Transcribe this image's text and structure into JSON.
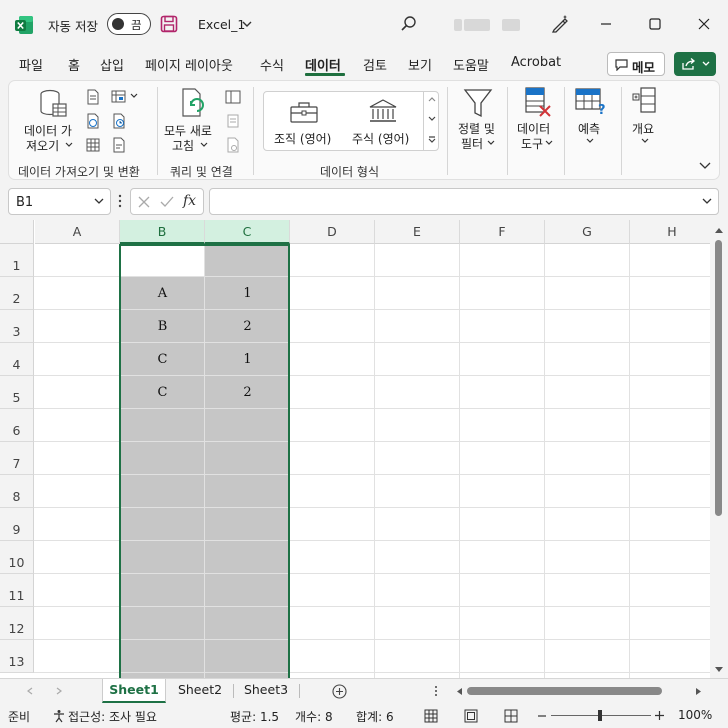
{
  "titlebar": {
    "autosave_label": "자동 저장",
    "autosave_state": "끔",
    "filename": "Excel_1",
    "colors": {
      "excel_green": "#1e7145"
    }
  },
  "tabs": [
    {
      "label": "파일"
    },
    {
      "label": "홈"
    },
    {
      "label": "삽입"
    },
    {
      "label": "페이지 레이아웃"
    },
    {
      "label": "수식"
    },
    {
      "label": "데이터",
      "active": true
    },
    {
      "label": "검토"
    },
    {
      "label": "보기"
    },
    {
      "label": "도움말"
    },
    {
      "label": "Acrobat"
    }
  ],
  "memo_label": "메모",
  "ribbon": {
    "get_data_l1": "데이터 가",
    "get_data_l2": "져오기",
    "group_get": "데이터 가져오기 및 변환",
    "refresh_l1": "모두 새로",
    "refresh_l2": "고침",
    "group_query": "쿼리 및 연결",
    "org_label": "조직 (영어)",
    "stock_label": "주식 (영어)",
    "group_types": "데이터 형식",
    "sort_l1": "정렬 및",
    "sort_l2": "필터",
    "tools_l1": "데이터",
    "tools_l2": "도구",
    "forecast": "예측",
    "outline": "개요"
  },
  "formula_bar": {
    "name_box": "B1",
    "fx": "fx",
    "formula": ""
  },
  "grid": {
    "columns": [
      "A",
      "B",
      "C",
      "D",
      "E",
      "F",
      "G",
      "H"
    ],
    "selected_columns": [
      "B",
      "C"
    ],
    "rows": [
      "1",
      "2",
      "3",
      "4",
      "5",
      "6",
      "7",
      "8",
      "9",
      "10",
      "11",
      "12",
      "13"
    ],
    "cells": {
      "B2": "A",
      "C2": "1",
      "B3": "B",
      "C3": "2",
      "B4": "C",
      "C4": "1",
      "B5": "C",
      "C5": "2"
    }
  },
  "sheets": [
    {
      "label": "Sheet1",
      "active": true
    },
    {
      "label": "Sheet2"
    },
    {
      "label": "Sheet3"
    }
  ],
  "status": {
    "ready": "준비",
    "accessibility": "접근성: 조사 필요",
    "average": "평균: 1.5",
    "count": "개수: 8",
    "sum": "합계: 6",
    "zoom": "100%"
  }
}
